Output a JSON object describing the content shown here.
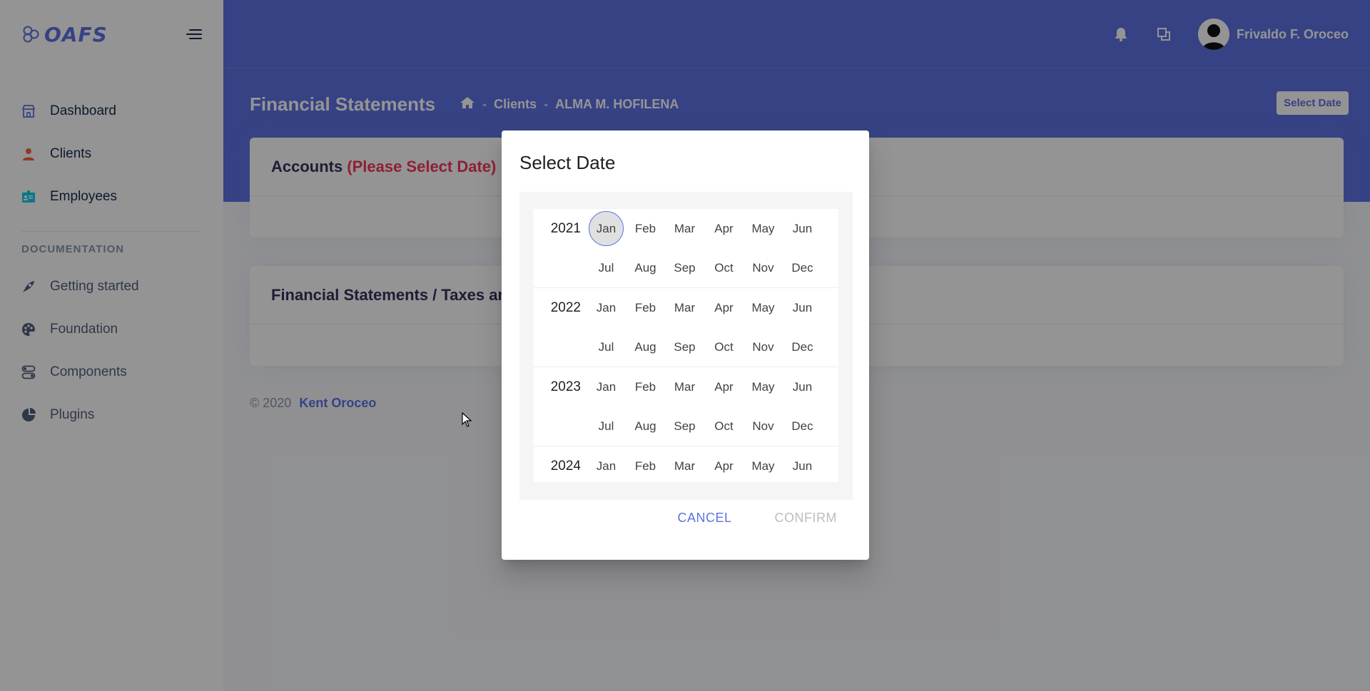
{
  "brand": {
    "logo_text": "OAFS",
    "accent": "#5e72e4"
  },
  "sidebar": {
    "items": [
      {
        "label": "Dashboard",
        "icon": "shop-icon"
      },
      {
        "label": "Clients",
        "icon": "user-icon"
      },
      {
        "label": "Employees",
        "icon": "badge-icon"
      }
    ],
    "doc_heading": "DOCUMENTATION",
    "doc_items": [
      {
        "label": "Getting started",
        "icon": "spaceship-icon"
      },
      {
        "label": "Foundation",
        "icon": "palette-icon"
      },
      {
        "label": "Components",
        "icon": "ui-04-icon"
      },
      {
        "label": "Plugins",
        "icon": "chart-pie-icon"
      }
    ]
  },
  "topbar": {
    "user_name": "Frivaldo F. Oroceo"
  },
  "header": {
    "title": "Financial Statements",
    "breadcrumb": [
      "Clients",
      "ALMA M. HOFILENA"
    ],
    "select_date_label": "Select Date"
  },
  "cards": {
    "accounts_title": "Accounts",
    "accounts_warning": "(Please Select Date)",
    "statements_title": "Financial Statements / Taxes an"
  },
  "footer": {
    "copyright": "© 2020",
    "author": "Kent Oroceo"
  },
  "dialog": {
    "title": "Select Date",
    "years": [
      {
        "year": "2021",
        "rows": [
          [
            "Jan",
            "Feb",
            "Mar",
            "Apr",
            "May",
            "Jun"
          ],
          [
            "Jul",
            "Aug",
            "Sep",
            "Oct",
            "Nov",
            "Dec"
          ]
        ]
      },
      {
        "year": "2022",
        "rows": [
          [
            "Jan",
            "Feb",
            "Mar",
            "Apr",
            "May",
            "Jun"
          ],
          [
            "Jul",
            "Aug",
            "Sep",
            "Oct",
            "Nov",
            "Dec"
          ]
        ]
      },
      {
        "year": "2023",
        "rows": [
          [
            "Jan",
            "Feb",
            "Mar",
            "Apr",
            "May",
            "Jun"
          ],
          [
            "Jul",
            "Aug",
            "Sep",
            "Oct",
            "Nov",
            "Dec"
          ]
        ]
      },
      {
        "year": "2024",
        "rows": [
          [
            "Jan",
            "Feb",
            "Mar",
            "Apr",
            "May",
            "Jun"
          ]
        ]
      }
    ],
    "selected": {
      "year": "2021",
      "month": "Jan"
    },
    "cancel_label": "CANCEL",
    "confirm_label": "CONFIRM"
  }
}
